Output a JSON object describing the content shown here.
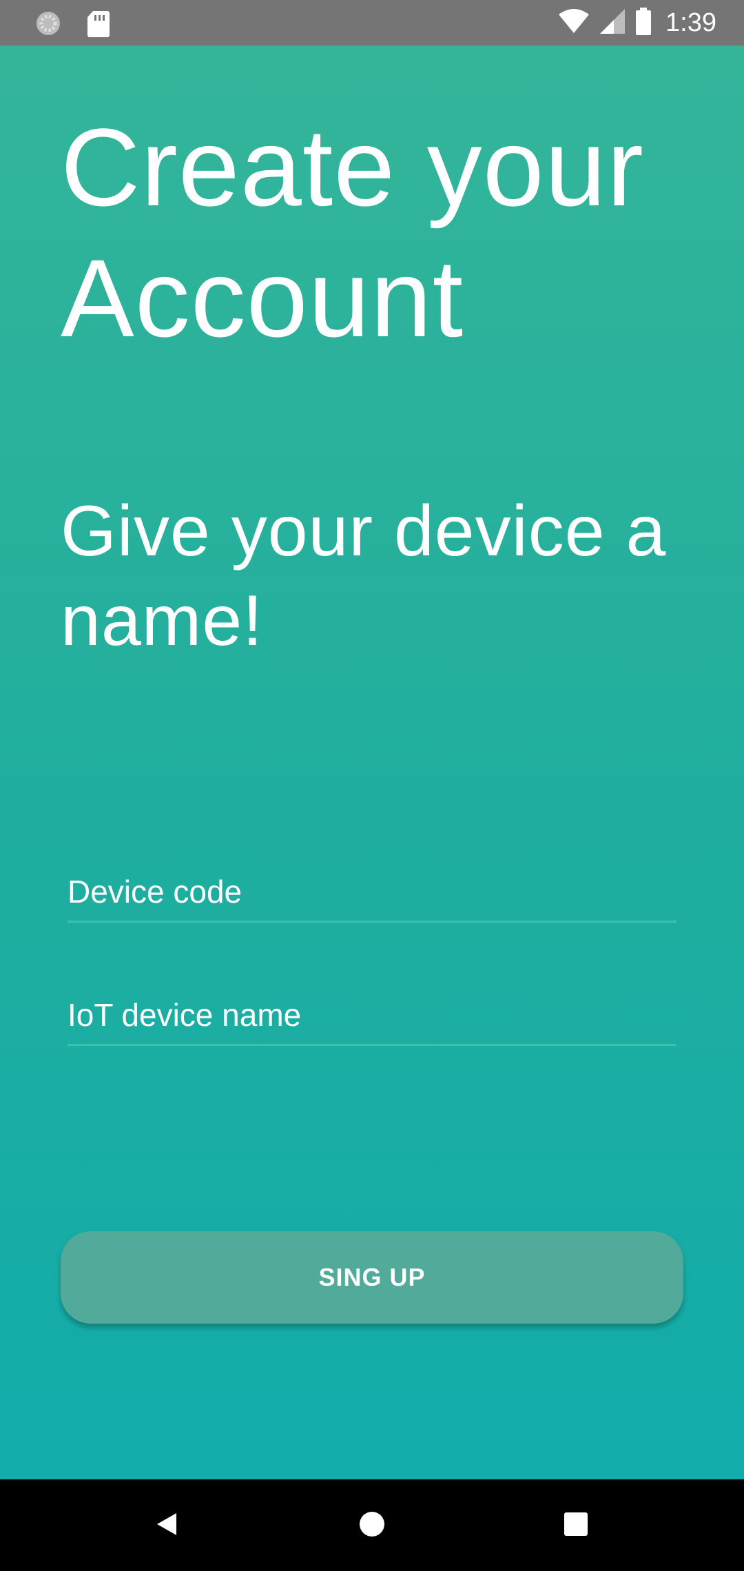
{
  "status_bar": {
    "time": "1:39",
    "left_icons": [
      "sync-icon",
      "sd-card-icon"
    ],
    "right_icons": [
      "wifi-icon",
      "cell-signal-icon",
      "battery-icon"
    ],
    "background": "#757575"
  },
  "main": {
    "title": "Create your Account",
    "subtitle": "Give your device a name!",
    "fields": {
      "device_code": {
        "value": "",
        "placeholder": "Device code"
      },
      "device_name": {
        "value": "",
        "placeholder": "IoT device name"
      }
    },
    "signup_button_label": "SING UP"
  },
  "colors": {
    "gradient_top": "#34b59a",
    "gradient_bottom": "#12acab",
    "button": "#52ab9a",
    "field_underline": "#3fc0a9"
  },
  "nav_bar": {
    "icons": [
      "back-icon",
      "home-icon",
      "recents-icon"
    ]
  }
}
